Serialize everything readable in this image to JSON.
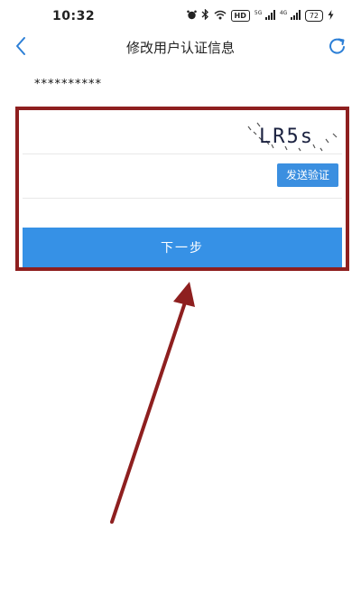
{
  "status_bar": {
    "time": "10:32",
    "icons": [
      "alarm-icon",
      "bluetooth-icon",
      "wifi-icon",
      "hd-icon",
      "signal-icon",
      "signal-icon",
      "battery-icon",
      "charging-icon"
    ],
    "hd_label": "HD",
    "net_label_1": "5G",
    "net_label_2": "4G",
    "battery_level": "72"
  },
  "nav": {
    "title": "修改用户认证信息",
    "back_icon": "chevron-left-icon",
    "refresh_icon": "refresh-icon"
  },
  "account": {
    "masked": "**********"
  },
  "form": {
    "captcha_text": "LR5s",
    "send_code_label": "发送验证",
    "next_label": "下一步"
  },
  "colors": {
    "accent": "#3691e6",
    "highlight": "#8e1f1f"
  }
}
